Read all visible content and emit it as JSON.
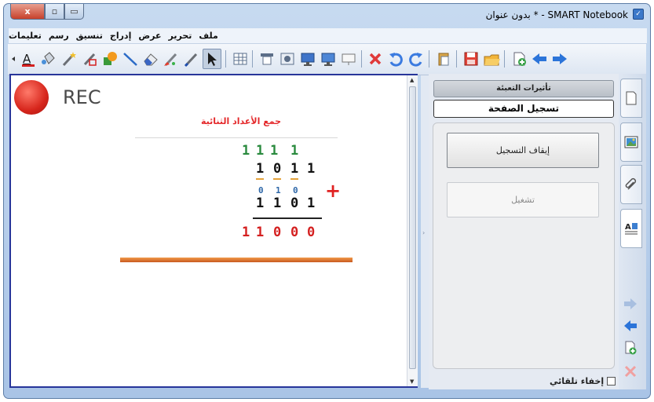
{
  "window": {
    "title": "SMART Notebook - * بدون عنوان",
    "close_glyph": "x",
    "maximize_glyph": "▫",
    "minimize_glyph": "▭"
  },
  "menu": [
    "ملف",
    "تحرير",
    "عرض",
    "إدراج",
    "تنسيق",
    "رسم",
    "تعليمات"
  ],
  "toolbar": {
    "icons": [
      "text-color-icon",
      "fill-bucket-icon",
      "magic-pen-icon",
      "shape-recognition-pen-icon",
      "shapes-icon",
      "line-icon",
      "eraser-icon",
      "creative-pen-icon",
      "pen-icon",
      "select-icon",
      "table-icon",
      "screen-shade-icon",
      "screen-capture-icon",
      "dual-page-icon",
      "display-icon",
      "document-camera-icon",
      "delete-icon",
      "undo-icon",
      "redo-icon",
      "paste-icon",
      "save-icon",
      "open-icon",
      "add-page-icon",
      "previous-page-icon",
      "next-page-icon"
    ]
  },
  "canvas": {
    "rec_label": "REC",
    "problem_title": "جمع الأعداد الثنائية",
    "carry_row": [
      "1",
      "1",
      "1",
      "1"
    ],
    "first_number": [
      "1",
      "0",
      "1",
      "1"
    ],
    "borrow_row": [
      "0",
      "1",
      "0"
    ],
    "second_number": [
      "1",
      "1",
      "0",
      "1"
    ],
    "result": [
      "1",
      "1",
      "0",
      "0",
      "0"
    ],
    "plus": "+"
  },
  "side_panel": {
    "tab_fill_effects": "تأثيرات التعبئة",
    "tab_page_recording": "تسجيل الصفحة",
    "stop_recording_button": "إيقاف التسجيل",
    "play_button": "تشغيل",
    "auto_hide_label": "إخفاء تلقائي"
  },
  "colors": {
    "accent_red": "#e4282a",
    "carry_green": "#2a8a3e",
    "borrow_blue": "#2e67a8",
    "page_border": "#27359a"
  }
}
